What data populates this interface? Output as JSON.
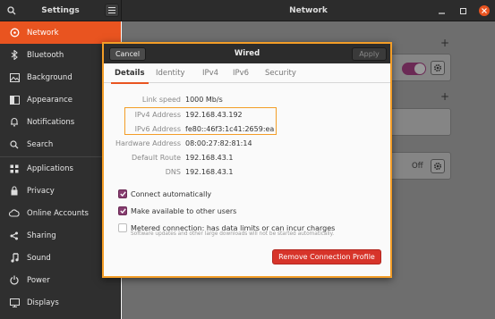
{
  "titlebar": {
    "settings_title": "Settings",
    "network_title": "Network",
    "search_icon": "search-icon",
    "menu_icon": "hamburger-menu-icon"
  },
  "sidebar": {
    "items": [
      {
        "label": "Network",
        "icon": "network-icon",
        "active": true
      },
      {
        "label": "Bluetooth",
        "icon": "bluetooth-icon"
      },
      {
        "label": "Background",
        "icon": "background-icon"
      },
      {
        "label": "Appearance",
        "icon": "appearance-icon"
      },
      {
        "label": "Notifications",
        "icon": "bell-icon"
      },
      {
        "label": "Search",
        "icon": "search-icon"
      },
      {
        "label": "Applications",
        "icon": "applications-icon"
      },
      {
        "label": "Privacy",
        "icon": "privacy-icon"
      },
      {
        "label": "Online Accounts",
        "icon": "cloud-icon"
      },
      {
        "label": "Sharing",
        "icon": "share-icon"
      },
      {
        "label": "Sound",
        "icon": "music-note-icon"
      },
      {
        "label": "Power",
        "icon": "power-icon"
      },
      {
        "label": "Displays",
        "icon": "display-icon"
      }
    ]
  },
  "main": {
    "vpn_status": "Off"
  },
  "dialog": {
    "title": "Wired",
    "cancel_label": "Cancel",
    "apply_label": "Apply",
    "tabs": [
      "Details",
      "Identity",
      "IPv4",
      "IPv6",
      "Security"
    ],
    "active_tab": "Details",
    "details": [
      {
        "label": "Link speed",
        "value": "1000 Mb/s"
      },
      {
        "label": "IPv4 Address",
        "value": "192.168.43.192"
      },
      {
        "label": "IPv6 Address",
        "value": "fe80::46f3:1c41:2659:ea"
      },
      {
        "label": "Hardware Address",
        "value": "08:00:27:82:81:14"
      },
      {
        "label": "Default Route",
        "value": "192.168.43.1"
      },
      {
        "label": "DNS",
        "value": "192.168.43.1"
      }
    ],
    "options": {
      "connect_auto": "Connect automatically",
      "available_others": "Make available to other users",
      "metered": "Metered connection: has data limits or can incur charges",
      "metered_sub": "Software updates and other large downloads will not be started automatically."
    },
    "remove_label": "Remove Connection Profile"
  },
  "colors": {
    "accent": "#e95420",
    "highlight": "#f39d27",
    "checkbox": "#873d70",
    "destructive": "#d7342a"
  }
}
